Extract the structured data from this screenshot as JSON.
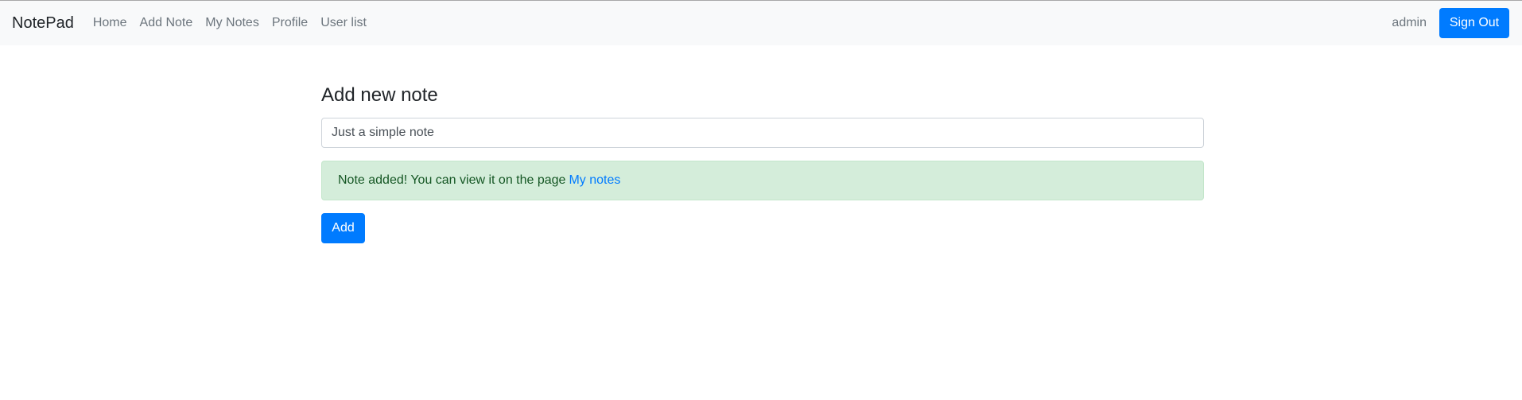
{
  "navbar": {
    "brand": "NotePad",
    "links": [
      "Home",
      "Add Note",
      "My Notes",
      "Profile",
      "User list"
    ],
    "username": "admin",
    "sign_out_label": "Sign Out"
  },
  "page": {
    "title": "Add new note",
    "note_input_value": "Just a simple note",
    "alert": {
      "message": "Note added! You can view it on the page",
      "link_text": "My notes"
    },
    "add_button_label": "Add"
  },
  "colors": {
    "primary": "#007bff",
    "navbar_bg": "#f8f9fa",
    "success_bg": "#d4edda",
    "success_text": "#155724"
  }
}
